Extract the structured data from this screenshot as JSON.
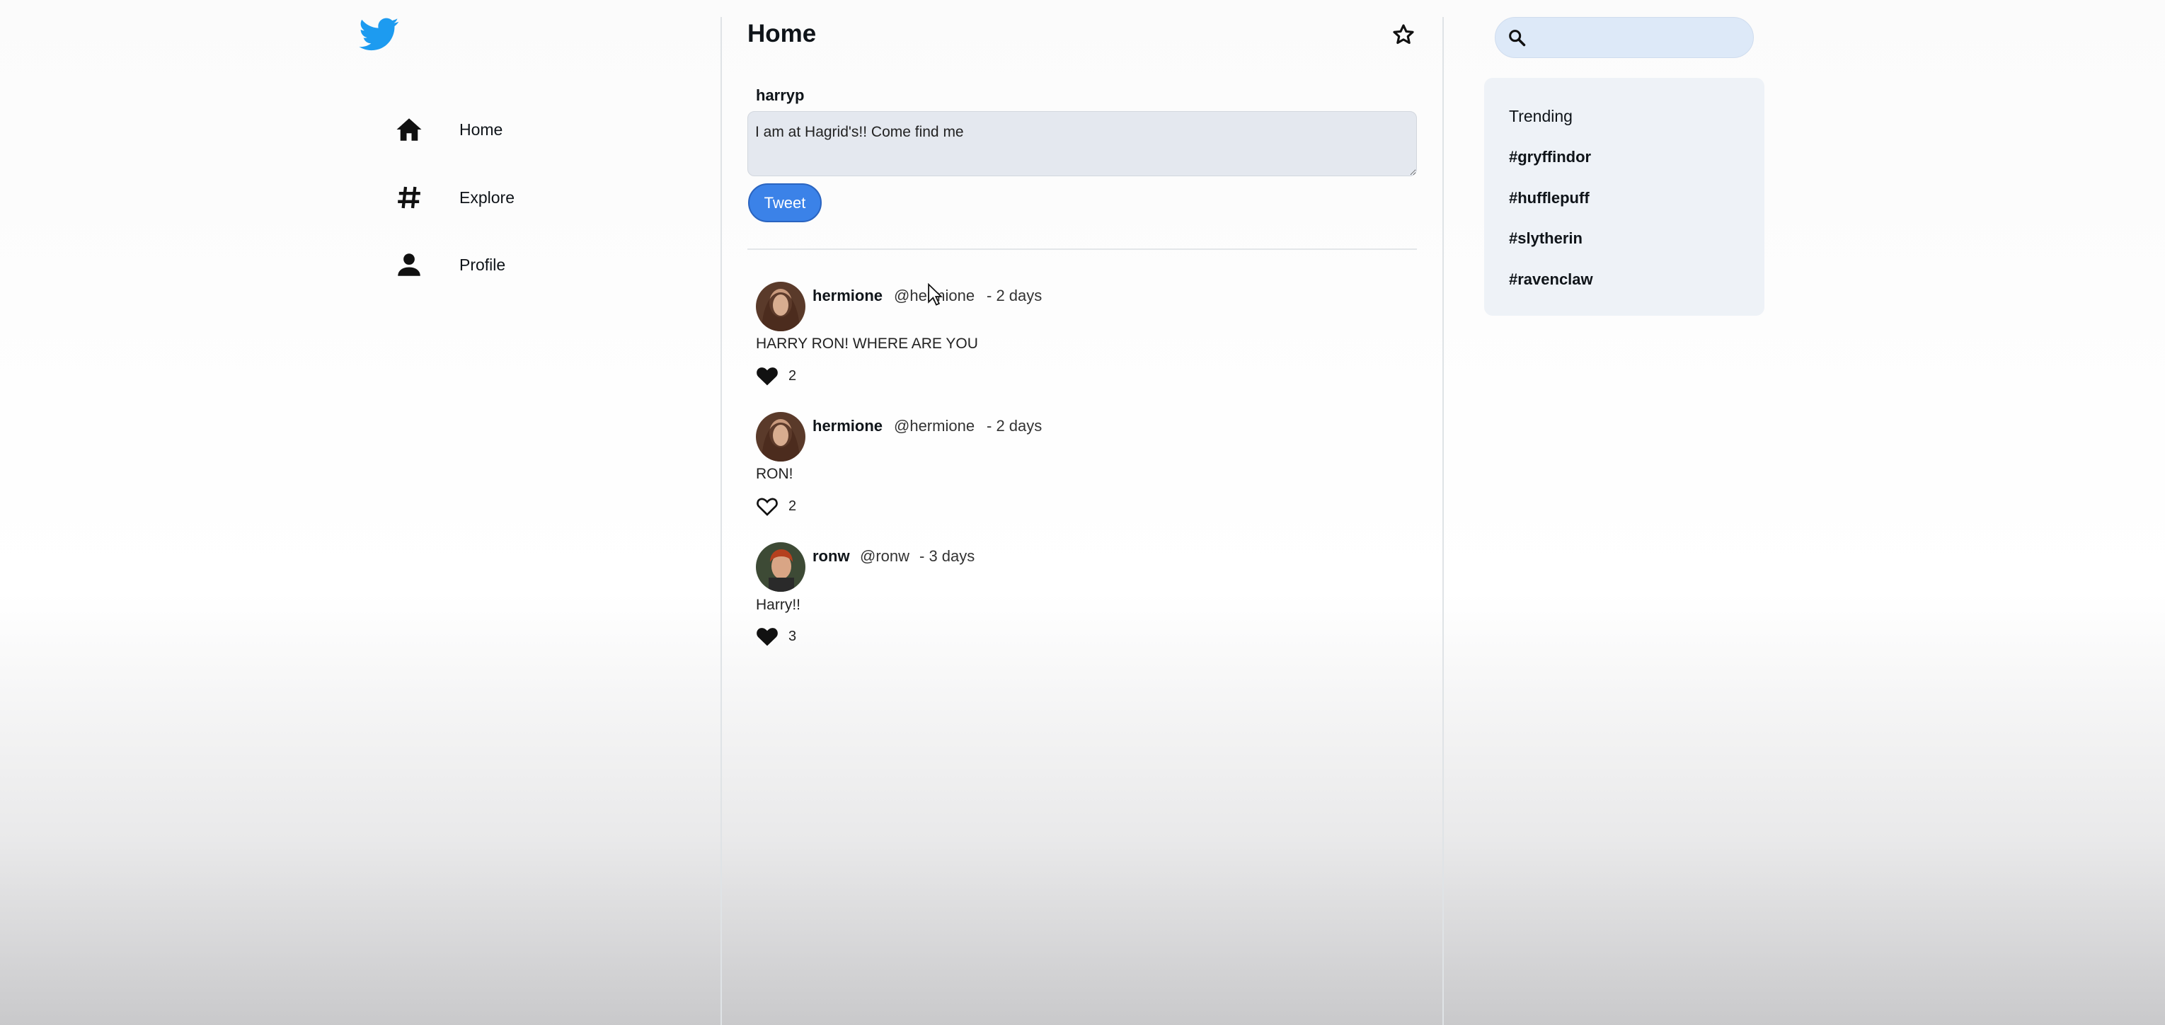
{
  "nav": {
    "items": [
      {
        "label": "Home",
        "icon": "home-icon"
      },
      {
        "label": "Explore",
        "icon": "hashtag-icon"
      },
      {
        "label": "Profile",
        "icon": "person-icon"
      }
    ]
  },
  "header": {
    "title": "Home"
  },
  "compose": {
    "username": "harryp",
    "text": "I am at Hagrid's!! Come find me",
    "button_label": "Tweet"
  },
  "tweets": [
    {
      "name": "hermione",
      "handle": "@hermione",
      "time": "- 2 days",
      "text": "HARRY RON! WHERE ARE YOU",
      "likes": "2",
      "liked": true
    },
    {
      "name": "hermione",
      "handle": "@hermione",
      "time": "- 2 days",
      "text": "RON!",
      "likes": "2",
      "liked": false
    },
    {
      "name": "ronw",
      "handle": "@ronw",
      "time": "- 3 days",
      "text": "Harry!!",
      "likes": "3",
      "liked": true
    }
  ],
  "trending": {
    "title": "Trending",
    "items": [
      "#gryffindor",
      "#hufflepuff",
      "#slytherin",
      "#ravenclaw"
    ]
  },
  "colors": {
    "brand": "#1d9bf0",
    "button": "#3b82e8",
    "search_bg": "#dde9f8",
    "panel_bg": "#eef2f7"
  }
}
